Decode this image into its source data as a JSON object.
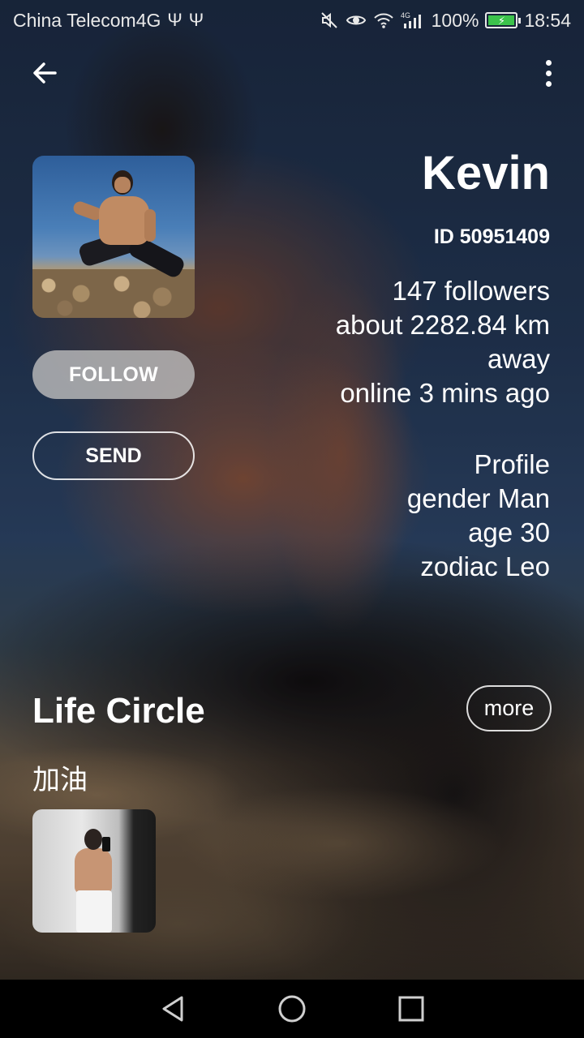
{
  "status_bar": {
    "carrier": "China Telecom4G",
    "usb_icons": [
      "usb-icon",
      "usb-icon"
    ],
    "right_icons": [
      "mute-icon",
      "eye-icon",
      "wifi-icon",
      "signal-4g-icon"
    ],
    "battery": "100%",
    "time": "18:54",
    "battery_color": "#3cc34b"
  },
  "profile": {
    "name": "Kevin",
    "id_text": "ID 50951409",
    "followers": "147 followers",
    "distance_line1": "about 2282.84 km",
    "distance_line2": "away",
    "online": "online 3 mins ago",
    "section_label": "Profile",
    "gender": "gender Man",
    "age": "age 30",
    "zodiac": "zodiac Leo"
  },
  "actions": {
    "follow": "FOLLOW",
    "send": "SEND"
  },
  "life_circle": {
    "title": "Life Circle",
    "more": "more",
    "post_text": "加油"
  },
  "nav": {
    "icons": [
      "back-triangle-icon",
      "home-circle-icon",
      "recents-square-icon"
    ]
  }
}
